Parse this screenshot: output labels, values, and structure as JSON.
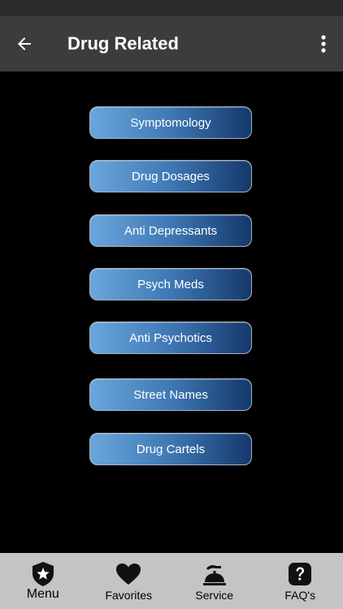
{
  "app_bar": {
    "title": "Drug Related",
    "back_icon": "arrow-left-icon",
    "overflow_icon": "more-vert-icon"
  },
  "menu": {
    "items": [
      {
        "label": "Symptomology"
      },
      {
        "label": "Drug Dosages"
      },
      {
        "label": "Anti Depressants"
      },
      {
        "label": "Psych Meds"
      },
      {
        "label": "Anti Psychotics"
      },
      {
        "label": "Street Names"
      },
      {
        "label": "Drug Cartels"
      }
    ]
  },
  "bottom_nav": {
    "items": [
      {
        "label": "Menu",
        "icon": "badge-star-icon"
      },
      {
        "label": "Favorites",
        "icon": "heart-icon"
      },
      {
        "label": "Service",
        "icon": "service-bell-icon"
      },
      {
        "label": "FAQ's",
        "icon": "question-icon"
      }
    ]
  },
  "colors": {
    "app_bar": "#3c3c3c",
    "background": "#000000",
    "bottom_nav": "#c4c4c4",
    "button_start": "#6aa6dc",
    "button_end": "#14386b"
  }
}
